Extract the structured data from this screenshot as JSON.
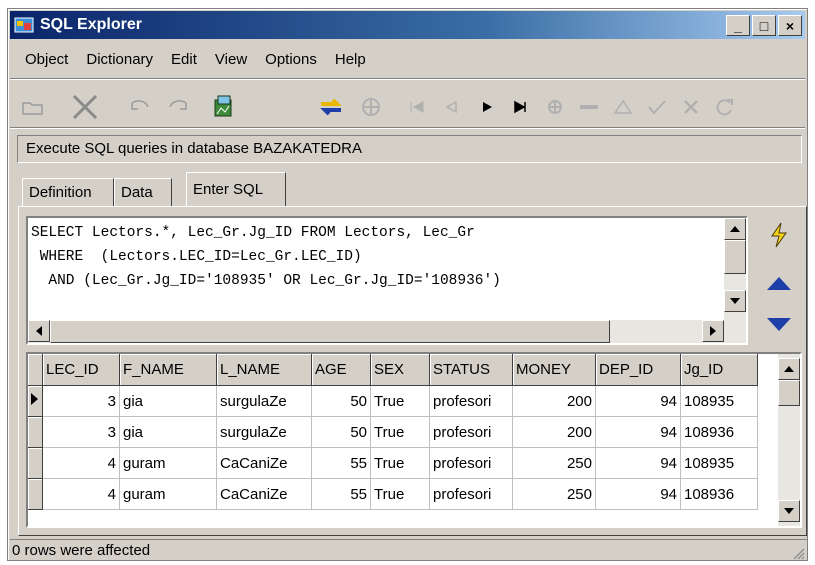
{
  "window": {
    "title": "SQL Explorer",
    "min": "_",
    "max": "□",
    "close": "×"
  },
  "menu": [
    "Object",
    "Dictionary",
    "Edit",
    "View",
    "Options",
    "Help"
  ],
  "toolbar_icons": [
    "open-folder-icon",
    "delete-x-icon",
    "undo-icon",
    "redo-icon",
    "dictionary-icon",
    "refresh-icon",
    "run-query-icon",
    "first-record-icon",
    "prior-record-icon",
    "next-record-icon",
    "last-record-icon",
    "insert-record-icon",
    "delete-record-icon",
    "edit-record-icon",
    "post-icon",
    "cancel-icon",
    "refresh-data-icon"
  ],
  "description": "Execute SQL queries in database BAZAKATEDRA",
  "tabs": [
    {
      "label": "Definition"
    },
    {
      "label": "Data"
    },
    {
      "label": "Enter SQL",
      "active": true
    }
  ],
  "sql": {
    "line1": "SELECT Lectors.*, Lec_Gr.Jg_ID FROM Lectors, Lec_Gr",
    "line2": " WHERE  (Lectors.LEC_ID=Lec_Gr.LEC_ID)",
    "line3": "  AND (Lec_Gr.Jg_ID='108935' OR Lec_Gr.Jg_ID='108936')"
  },
  "grid": {
    "columns": [
      "LEC_ID",
      "F_NAME",
      "L_NAME",
      "AGE",
      "SEX",
      "STATUS",
      "MONEY",
      "DEP_ID",
      "Jg_ID"
    ],
    "rows": [
      [
        "3",
        "gia",
        "surgulaZe",
        "50",
        "True",
        "profesori",
        "200",
        "94",
        "108935"
      ],
      [
        "3",
        "gia",
        "surgulaZe",
        "50",
        "True",
        "profesori",
        "200",
        "94",
        "108936"
      ],
      [
        "4",
        "guram",
        "CaCaniZe",
        "55",
        "True",
        "profesori",
        "250",
        "94",
        "108935"
      ],
      [
        "4",
        "guram",
        "CaCaniZe",
        "55",
        "True",
        "profesori",
        "250",
        "94",
        "108936"
      ]
    ],
    "current_row": 0
  },
  "status": "0 rows were affected",
  "colors": {
    "title_start": "#0a246a",
    "title_end": "#a6caf0",
    "face": "#d4d0c8",
    "accent_blue": "#1f3fa8",
    "lightning": "#f2d21b"
  }
}
